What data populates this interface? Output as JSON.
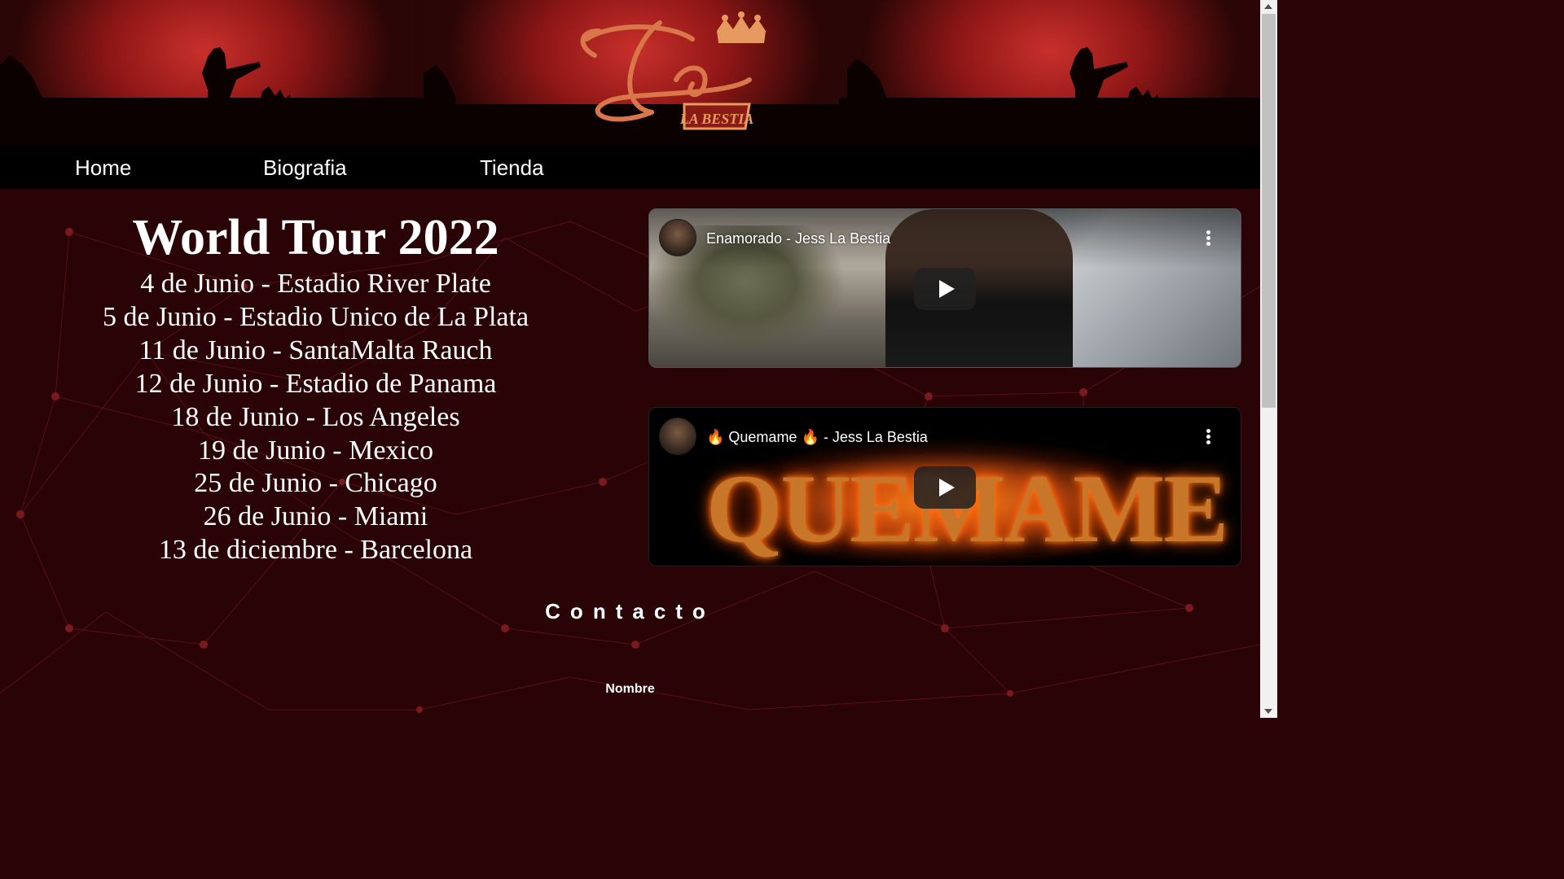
{
  "brand": {
    "logo_name": "Jess La Bestia"
  },
  "nav": {
    "items": [
      {
        "label": "Home"
      },
      {
        "label": "Biografia"
      },
      {
        "label": "Tienda"
      }
    ]
  },
  "tour": {
    "title": "World Tour 2022",
    "dates": [
      "4 de Junio - Estadio River Plate",
      "5 de Junio - Estadio Unico de La Plata",
      "11 de Junio - SantaMalta Rauch",
      "12 de Junio - Estadio de Panama",
      "18 de Junio - Los Angeles",
      "19 de Junio - Mexico",
      "25 de Junio - Chicago",
      "26 de Junio - Miami",
      "13 de diciembre - Barcelona"
    ]
  },
  "videos": [
    {
      "title": "Enamorado - Jess La Bestia"
    },
    {
      "title": "🔥 Quemame 🔥 - Jess La Bestia",
      "thumb_word": "QUEMAME"
    }
  ],
  "contact": {
    "title": "Contacto",
    "name_label": "Nombre"
  },
  "colors": {
    "background": "#2a0306",
    "nav": "#000000",
    "text": "#ffffff",
    "accent": "#c8302b"
  }
}
